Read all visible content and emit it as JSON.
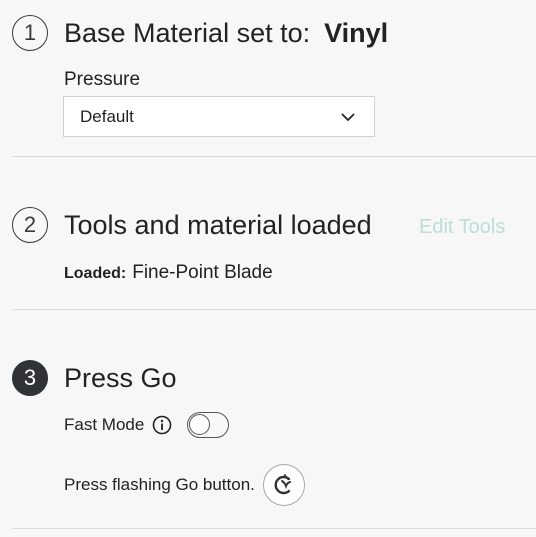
{
  "step1": {
    "number": "1",
    "title_prefix": "Base Material set to:",
    "material": "Vinyl",
    "pressure_label": "Pressure",
    "pressure_value": "Default"
  },
  "step2": {
    "number": "2",
    "title": "Tools and material loaded",
    "edit_tools_label": "Edit Tools",
    "loaded_label": "Loaded:",
    "loaded_value": "Fine-Point Blade"
  },
  "step3": {
    "number": "3",
    "title": "Press Go",
    "fast_mode_label": "Fast Mode",
    "fast_mode_on": false,
    "go_instruction": "Press flashing Go button."
  },
  "colors": {
    "edit_tools": "#b9dfd7",
    "active_badge": "#2f3338",
    "background": "#f7f7f7"
  },
  "icons": {
    "info": "info-icon",
    "dropdown": "chevron-down-icon",
    "go": "cricut-go-icon"
  }
}
